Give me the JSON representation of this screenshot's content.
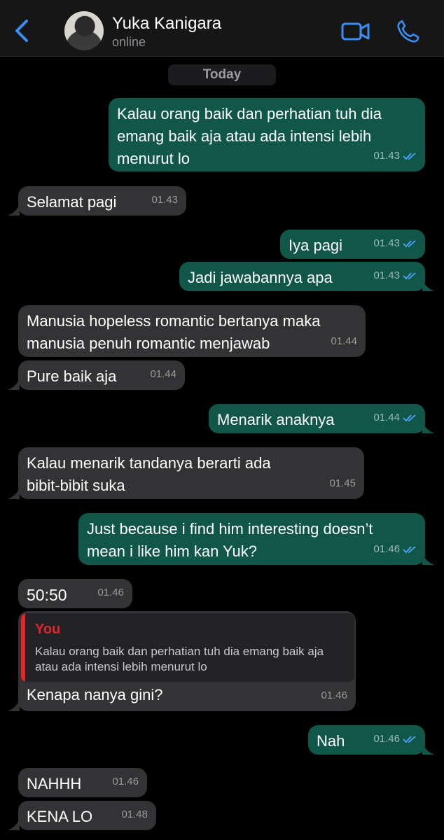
{
  "header": {
    "contact_name": "Yuka Kanigara",
    "status": "online",
    "icons": [
      "chevron-left-icon",
      "avatar",
      "video-camera-icon",
      "phone-icon"
    ],
    "accent_color": "#3a8ef6"
  },
  "date_label": "Today",
  "colors": {
    "outgoing_bubble": "#10574a",
    "incoming_bubble": "#333335",
    "background": "#000000",
    "read_ticks": "#4fa3ff",
    "reply_accent": "#e3242b"
  },
  "messages": [
    {
      "dir": "out",
      "text": "Kalau orang baik dan perhatian tuh dia\nemang baik aja atau ada intensi lebih\nmenurut lo",
      "time": "01.43",
      "read": true
    },
    {
      "dir": "in",
      "text": "Selamat pagi",
      "time": "01.43"
    },
    {
      "dir": "out",
      "text": "Iya pagi",
      "time": "01.43",
      "read": true
    },
    {
      "dir": "out",
      "text": "Jadi jawabannya apa",
      "time": "01.43",
      "read": true
    },
    {
      "dir": "in",
      "text": "Manusia hopeless romantic bertanya maka\nmanusia penuh romantic menjawab",
      "time": "01.44"
    },
    {
      "dir": "in",
      "text": "Pure baik aja",
      "time": "01.44"
    },
    {
      "dir": "out",
      "text": "Menarik anaknya",
      "time": "01.44",
      "read": true
    },
    {
      "dir": "in",
      "text": "Kalau menarik tandanya berarti ada\nbibit-bibit suka",
      "time": "01.45"
    },
    {
      "dir": "out",
      "text": "Just because i find him interesting doesn’t\nmean i like him kan Yuk?",
      "time": "01.46",
      "read": true
    },
    {
      "dir": "in",
      "text": "50:50",
      "time": "01.46"
    },
    {
      "dir": "in",
      "text": "Kenapa nanya gini?",
      "time": "01.46"
    },
    {
      "dir": "out",
      "text": "Nah",
      "time": "01.46",
      "read": true
    },
    {
      "dir": "in",
      "text": "NAHHH",
      "time": "01.46"
    },
    {
      "dir": "in",
      "text": "KENA LO",
      "time": "01.48"
    }
  ],
  "reply": {
    "author": "You",
    "text": "Kalau orang baik dan perhatian tuh dia emang baik aja atau ada intensi lebih menurut lo"
  }
}
